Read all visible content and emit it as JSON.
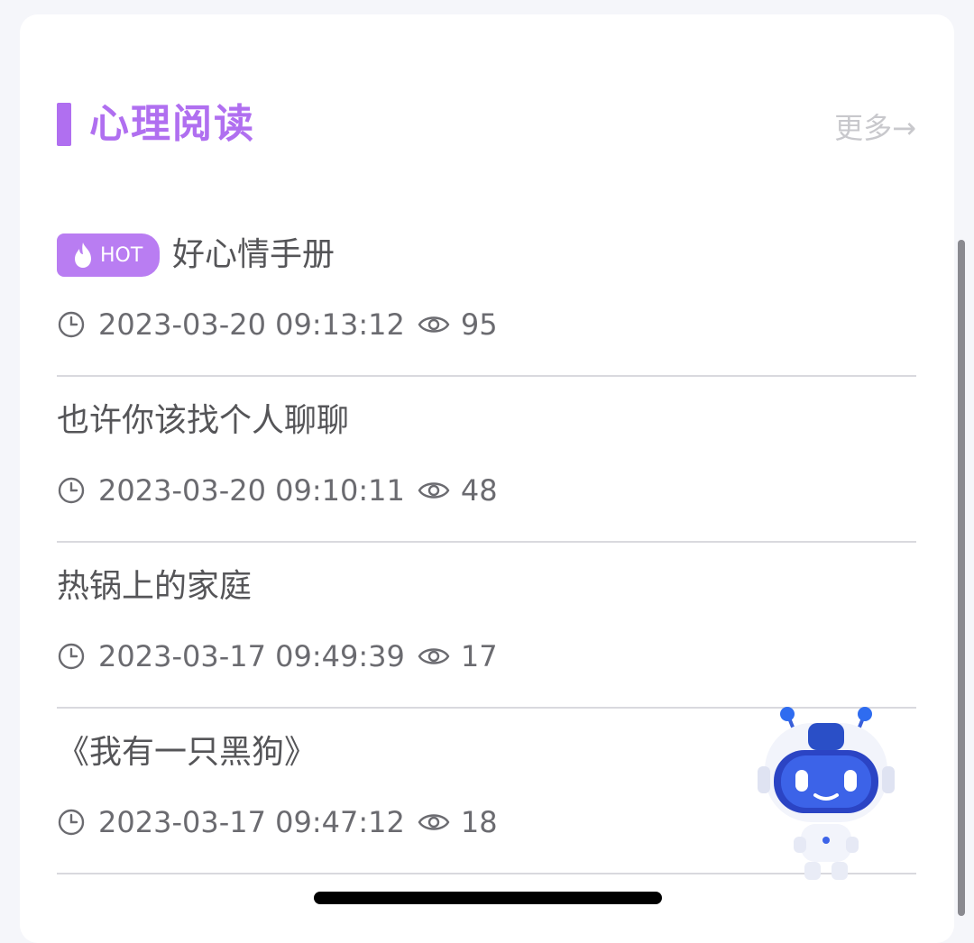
{
  "section": {
    "title": "心理阅读",
    "more_label": "更多→",
    "accent_color": "#b06ff0"
  },
  "articles": [
    {
      "hot": true,
      "badge": "HOT",
      "title": "好心情手册",
      "datetime": "2023-03-20 09:13:12",
      "views": "95"
    },
    {
      "hot": false,
      "title": "也许你该找个人聊聊",
      "datetime": "2023-03-20 09:10:11",
      "views": "48"
    },
    {
      "hot": false,
      "title": "热锅上的家庭",
      "datetime": "2023-03-17 09:49:39",
      "views": "17"
    },
    {
      "hot": false,
      "title": "《我有一只黑狗》",
      "datetime": "2023-03-17 09:47:12",
      "views": "18"
    }
  ],
  "icons": {
    "clock": "clock-icon",
    "views": "eye-icon",
    "hot": "flame-icon",
    "assistant": "robot-assistant-icon"
  }
}
